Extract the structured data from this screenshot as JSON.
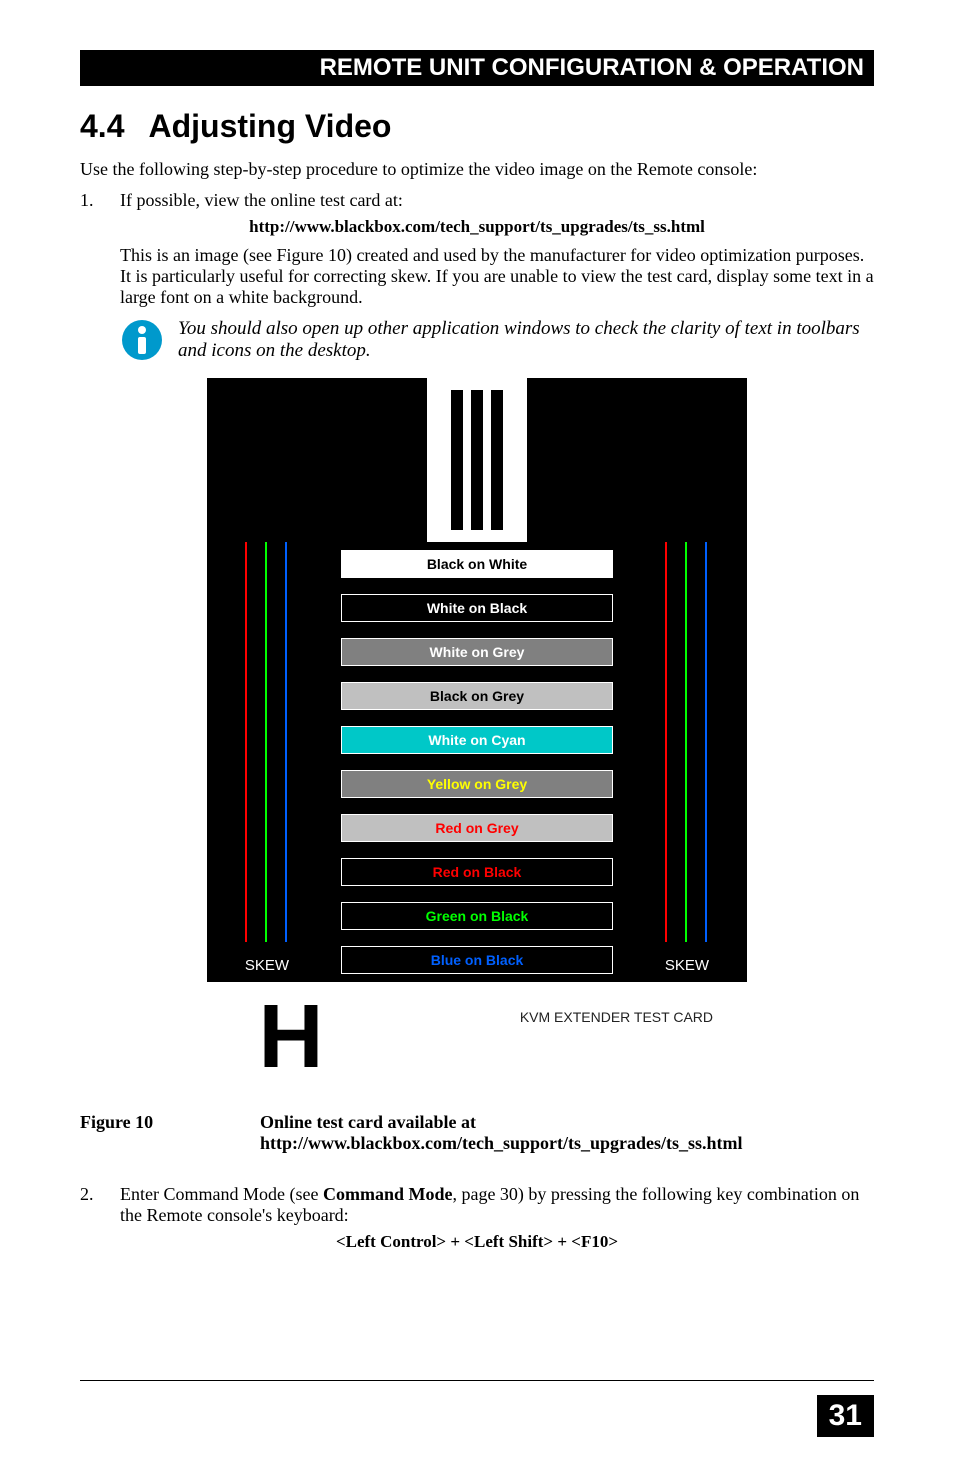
{
  "header": "REMOTE UNIT CONFIGURATION & OPERATION",
  "section": {
    "num": "4.4",
    "title": "Adjusting Video"
  },
  "intro": "Use the following step-by-step procedure to optimize the video image on the Remote console:",
  "step1": {
    "num": "1.",
    "text": "If possible, view the online test card at:"
  },
  "url1": "http://www.blackbox.com/tech_support/ts_upgrades/ts_ss.html",
  "sub1": "This is an image (see Figure 10) created and used by the manufacturer for video optimization purposes. It is particularly useful for correcting skew. If you are unable to view the test card, display some text in a large font on a white background.",
  "info": "You should also open up other application windows to check the clarity of text in toolbars and icons on the desktop.",
  "testcard": {
    "skew_label": "SKEW",
    "bars": [
      {
        "label": "Black on White",
        "bg": "#ffffff",
        "fg": "#000000"
      },
      {
        "label": "White on Black",
        "bg": "#000000",
        "fg": "#ffffff"
      },
      {
        "label": "White on Grey",
        "bg": "#808080",
        "fg": "#ffffff"
      },
      {
        "label": "Black on Grey",
        "bg": "#c0c0c0",
        "fg": "#000000"
      },
      {
        "label": "White on Cyan",
        "bg": "#00c8c8",
        "fg": "#ffffff"
      },
      {
        "label": "Yellow on Grey",
        "bg": "#808080",
        "fg": "#ffff00"
      },
      {
        "label": "Red on Grey",
        "bg": "#c0c0c0",
        "fg": "#ff0000"
      },
      {
        "label": "Red on Black",
        "bg": "#000000",
        "fg": "#ff0000"
      },
      {
        "label": "Green on Black",
        "bg": "#000000",
        "fg": "#00ff00"
      },
      {
        "label": "Blue on Black",
        "bg": "#000000",
        "fg": "#0060ff"
      }
    ],
    "h_letter": "H",
    "ext_label": "KVM EXTENDER TEST CARD"
  },
  "figure": {
    "label": "Figure 10",
    "title": "Online test card available at",
    "url": "http://www.blackbox.com/tech_support/ts_upgrades/ts_ss.html"
  },
  "step2": {
    "num": "2.",
    "text_a": "Enter Command Mode (see ",
    "bold": "Command Mode",
    "text_b": ", page 30) by pressing the following key combination on the Remote console's keyboard:"
  },
  "cmd": "<Left Control> + <Left Shift> + <F10>",
  "page_num": "31"
}
